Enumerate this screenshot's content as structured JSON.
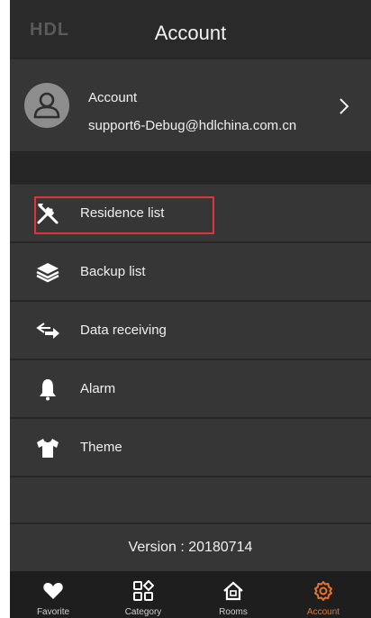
{
  "header": {
    "logo": "HDL",
    "title": "Account"
  },
  "account": {
    "name_label": "Account",
    "email": "support6-Debug@hdlchina.com.cn"
  },
  "menu": {
    "items": [
      {
        "label": "Residence list",
        "icon": "tools-icon"
      },
      {
        "label": "Backup list",
        "icon": "layers-icon"
      },
      {
        "label": "Data receiving",
        "icon": "transfer-arrows-icon"
      },
      {
        "label": "Alarm",
        "icon": "bell-icon"
      },
      {
        "label": "Theme",
        "icon": "tshirt-icon"
      }
    ]
  },
  "version": "Version : 20180714",
  "tabbar": {
    "tabs": [
      {
        "label": "Favorite",
        "icon": "heart-icon"
      },
      {
        "label": "Category",
        "icon": "category-grid-icon"
      },
      {
        "label": "Rooms",
        "icon": "house-icon"
      },
      {
        "label": "Account",
        "icon": "gear-icon",
        "active": true
      }
    ]
  },
  "colors": {
    "accent": "#e8742c",
    "highlight_box": "#e0343a",
    "background": "#2b2b2b"
  }
}
